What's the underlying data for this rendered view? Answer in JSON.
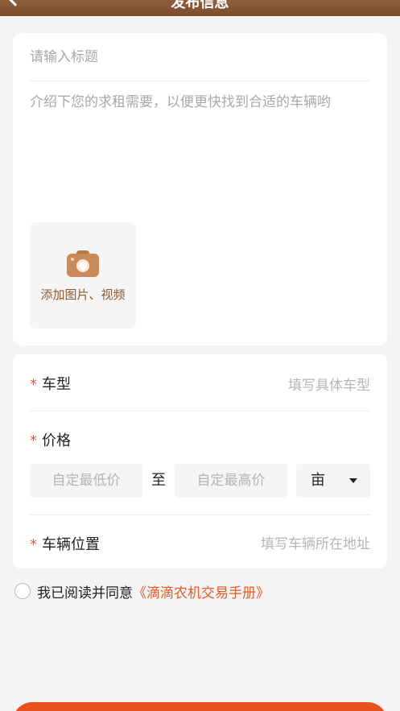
{
  "header": {
    "title": "发布信息"
  },
  "form": {
    "title_placeholder": "请输入标题",
    "desc_placeholder": "介绍下您的求租需要，以便更快找到合适的车辆哟",
    "upload_label": "添加图片、视频"
  },
  "details": {
    "required_mark": "*",
    "model_label": "车型",
    "model_placeholder": "填写具体车型",
    "price_label": "价格",
    "price_min_placeholder": "自定最低价",
    "price_sep": "至",
    "price_max_placeholder": "自定最高价",
    "unit": "亩",
    "location_label": "车辆位置",
    "location_placeholder": "填写车辆所在地址"
  },
  "agreement": {
    "text": "我已阅读并同意",
    "link": "《滴滴农机交易手册》"
  },
  "colors": {
    "accent": "#e8511c",
    "brand_brown": "#8b5a33",
    "required": "#e8553b"
  }
}
